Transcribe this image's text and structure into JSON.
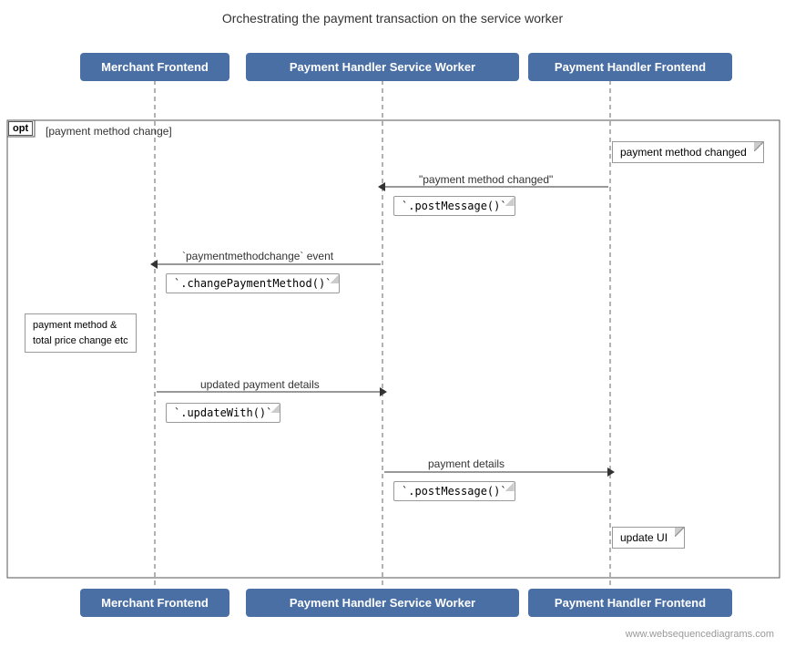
{
  "title": "Orchestrating the payment transaction on the service worker",
  "actors": [
    {
      "id": "merchant",
      "label": "Merchant Frontend"
    },
    {
      "id": "service_worker",
      "label": "Payment Handler Service Worker"
    },
    {
      "id": "handler_frontend",
      "label": "Payment Handler Frontend"
    }
  ],
  "opt_frame": {
    "label": "opt",
    "condition": "[payment method change]"
  },
  "notes": [
    {
      "id": "payment_method_changed_note",
      "text": "payment method changed"
    },
    {
      "id": "update_ui_note",
      "text": "update UI"
    }
  ],
  "side_note": {
    "text": "payment method &\ntotal price change etc"
  },
  "arrows": [
    {
      "id": "arrow1",
      "label": "\"payment method changed\"",
      "direction": "left"
    },
    {
      "id": "arrow2",
      "label": "`paymentmethodchange` event",
      "direction": "left"
    },
    {
      "id": "arrow3",
      "label": "updated payment details",
      "direction": "right"
    },
    {
      "id": "arrow4",
      "label": "payment details",
      "direction": "right"
    }
  ],
  "method_boxes": [
    {
      "id": "post_message_1",
      "text": "`.postMessage()`"
    },
    {
      "id": "change_payment",
      "text": "`.changePaymentMethod()`"
    },
    {
      "id": "update_with",
      "text": "`.updateWith()`"
    },
    {
      "id": "post_message_2",
      "text": "`.postMessage()`"
    }
  ],
  "watermark": "www.websequencediagrams.com"
}
